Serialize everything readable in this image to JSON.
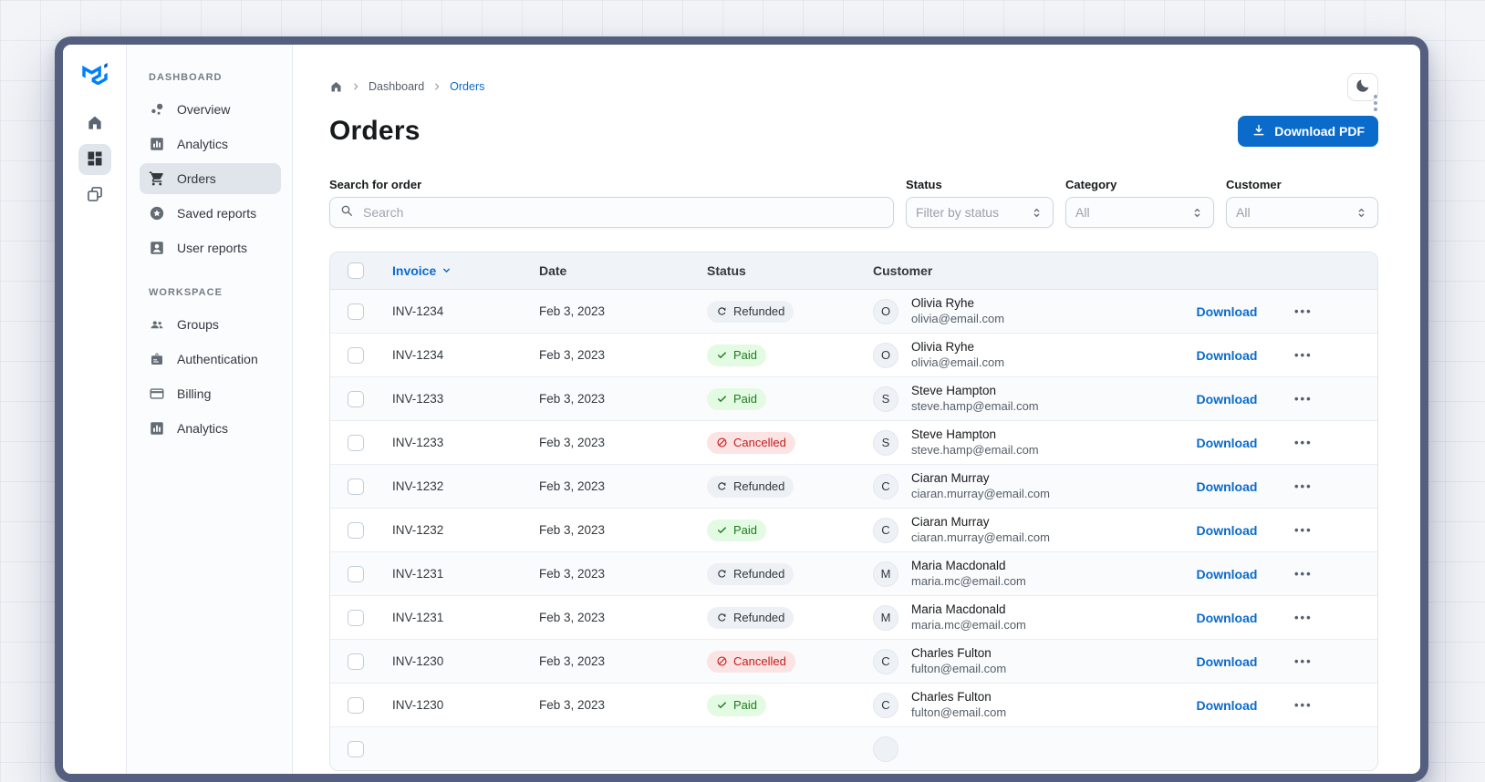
{
  "sidebar_rail": {
    "buttons": [
      {
        "icon": "home",
        "selected": false
      },
      {
        "icon": "dashboard-grid",
        "selected": true
      },
      {
        "icon": "overlapping-windows",
        "selected": false
      }
    ]
  },
  "sidebar": {
    "sections": [
      {
        "label": "DASHBOARD",
        "items": [
          {
            "label": "Overview",
            "icon": "bubble-chart",
            "selected": false
          },
          {
            "label": "Analytics",
            "icon": "bar-chart",
            "selected": false
          },
          {
            "label": "Orders",
            "icon": "shopping-cart",
            "selected": true
          },
          {
            "label": "Saved reports",
            "icon": "star-circle",
            "selected": false
          },
          {
            "label": "User reports",
            "icon": "person-card",
            "selected": false
          }
        ]
      },
      {
        "label": "WORKSPACE",
        "items": [
          {
            "label": "Groups",
            "icon": "people",
            "selected": false
          },
          {
            "label": "Authentication",
            "icon": "badge",
            "selected": false
          },
          {
            "label": "Billing",
            "icon": "credit-card",
            "selected": false
          },
          {
            "label": "Analytics",
            "icon": "bar-chart",
            "selected": false
          }
        ]
      }
    ]
  },
  "breadcrumb": {
    "items": [
      "Dashboard",
      "Orders"
    ]
  },
  "header": {
    "title": "Orders",
    "download_button": "Download PDF",
    "theme_toggle_icon": "moon"
  },
  "filters": {
    "search": {
      "label": "Search for order",
      "placeholder": "Search"
    },
    "status": {
      "label": "Status",
      "value": "Filter by status"
    },
    "category": {
      "label": "Category",
      "value": "All"
    },
    "customer": {
      "label": "Customer",
      "value": "All"
    }
  },
  "table": {
    "columns": [
      "Invoice",
      "Date",
      "Status",
      "Customer"
    ],
    "sorted_column": "Invoice",
    "sort_direction": "desc",
    "row_actions": {
      "download": "Download",
      "more": "•••"
    },
    "rows": [
      {
        "invoice": "INV-1234",
        "date": "Feb 3, 2023",
        "status": "Refunded",
        "initial": "O",
        "name": "Olivia Ryhe",
        "email": "olivia@email.com"
      },
      {
        "invoice": "INV-1234",
        "date": "Feb 3, 2023",
        "status": "Paid",
        "initial": "O",
        "name": "Olivia Ryhe",
        "email": "olivia@email.com"
      },
      {
        "invoice": "INV-1233",
        "date": "Feb 3, 2023",
        "status": "Paid",
        "initial": "S",
        "name": "Steve Hampton",
        "email": "steve.hamp@email.com"
      },
      {
        "invoice": "INV-1233",
        "date": "Feb 3, 2023",
        "status": "Cancelled",
        "initial": "S",
        "name": "Steve Hampton",
        "email": "steve.hamp@email.com"
      },
      {
        "invoice": "INV-1232",
        "date": "Feb 3, 2023",
        "status": "Refunded",
        "initial": "C",
        "name": "Ciaran Murray",
        "email": "ciaran.murray@email.com"
      },
      {
        "invoice": "INV-1232",
        "date": "Feb 3, 2023",
        "status": "Paid",
        "initial": "C",
        "name": "Ciaran Murray",
        "email": "ciaran.murray@email.com"
      },
      {
        "invoice": "INV-1231",
        "date": "Feb 3, 2023",
        "status": "Refunded",
        "initial": "M",
        "name": "Maria Macdonald",
        "email": "maria.mc@email.com"
      },
      {
        "invoice": "INV-1231",
        "date": "Feb 3, 2023",
        "status": "Refunded",
        "initial": "M",
        "name": "Maria Macdonald",
        "email": "maria.mc@email.com"
      },
      {
        "invoice": "INV-1230",
        "date": "Feb 3, 2023",
        "status": "Cancelled",
        "initial": "C",
        "name": "Charles Fulton",
        "email": "fulton@email.com"
      },
      {
        "invoice": "INV-1230",
        "date": "Feb 3, 2023",
        "status": "Paid",
        "initial": "C",
        "name": "Charles Fulton",
        "email": "fulton@email.com"
      },
      {
        "invoice": "",
        "date": "",
        "status": "",
        "initial": "",
        "name": "",
        "email": ""
      }
    ]
  },
  "colors": {
    "primary": "#0B6BCB",
    "frame": "#545F80",
    "paid_bg": "#E3FBE3",
    "paid_text": "#1F7A1F",
    "refunded_bg": "#EDF0F4",
    "refunded_text": "#32383E",
    "cancelled_bg": "#FCE4E4",
    "cancelled_text": "#C41C1C",
    "table_header_bg": "#F0F4F8",
    "selected_nav_bg": "#E0E5EC"
  }
}
